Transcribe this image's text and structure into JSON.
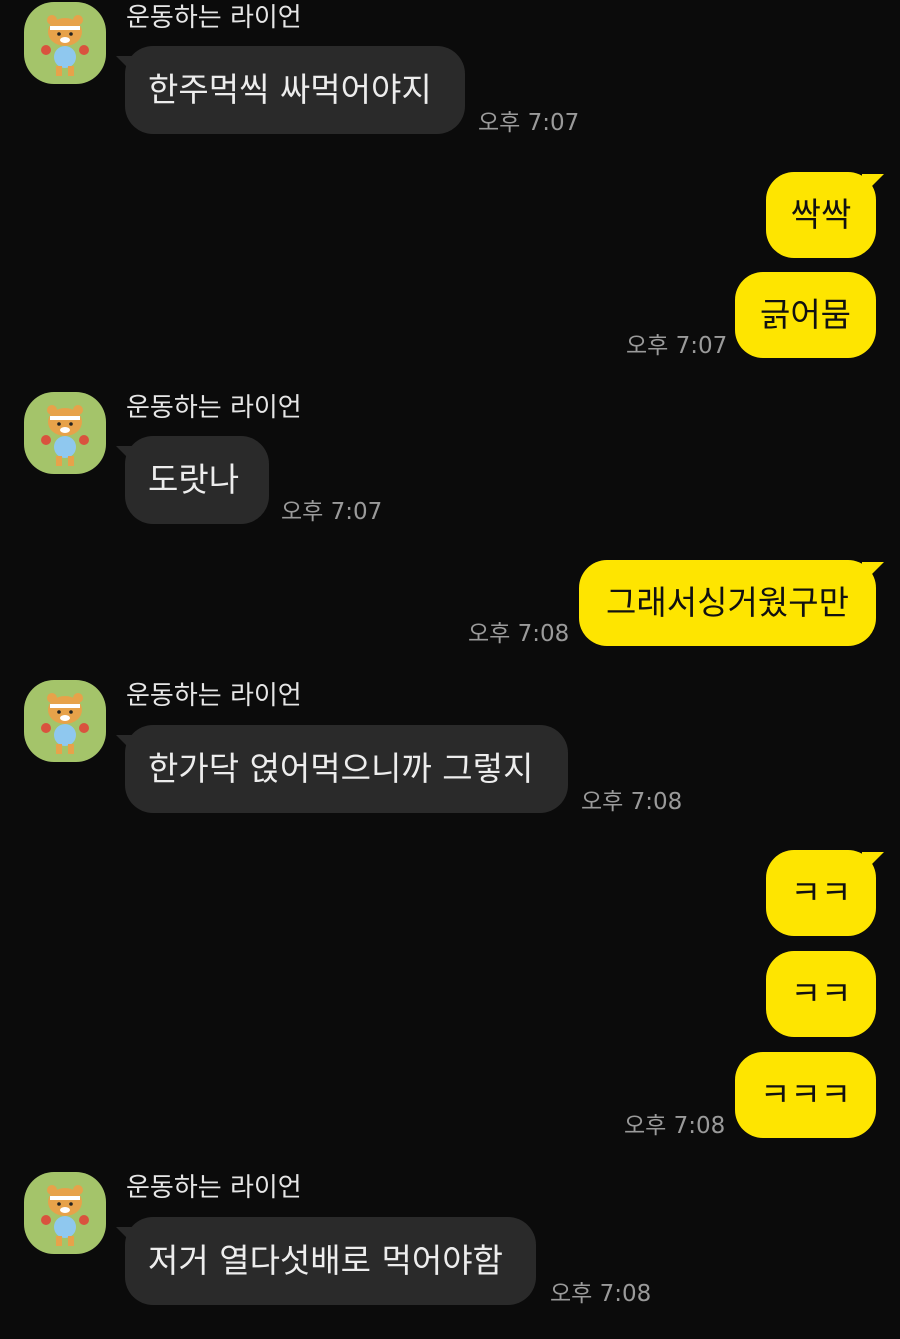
{
  "conversation": {
    "sender_name": "운동하는 라이언",
    "avatar_icon": "ryan-lion-character-icon",
    "colors": {
      "background": "#0b0b0b",
      "incoming_bubble": "#2a2a2a",
      "outgoing_bubble": "#fee500",
      "timestamp": "#9a9a9a"
    },
    "messages": [
      {
        "direction": "incoming",
        "sender": "운동하는 라이언",
        "text": "한주먹씩 싸먹어야지",
        "time": "오후 7:07"
      },
      {
        "direction": "outgoing",
        "text": "싹싹"
      },
      {
        "direction": "outgoing",
        "text": "긁어뭄",
        "time": "오후 7:07"
      },
      {
        "direction": "incoming",
        "sender": "운동하는 라이언",
        "text": "도랏나",
        "time": "오후 7:07"
      },
      {
        "direction": "outgoing",
        "text": "그래서싱거웠구만",
        "time": "오후 7:08"
      },
      {
        "direction": "incoming",
        "sender": "운동하는 라이언",
        "text": "한가닥 얹어먹으니까 그렇지",
        "time": "오후 7:08"
      },
      {
        "direction": "outgoing",
        "text": "ㅋㅋ"
      },
      {
        "direction": "outgoing",
        "text": "ㅋㅋ"
      },
      {
        "direction": "outgoing",
        "text": "ㅋㅋㅋ",
        "time": "오후 7:08"
      },
      {
        "direction": "incoming",
        "sender": "운동하는 라이언",
        "text": "저거 열다섯배로 먹어야함",
        "time": "오후 7:08"
      }
    ]
  }
}
